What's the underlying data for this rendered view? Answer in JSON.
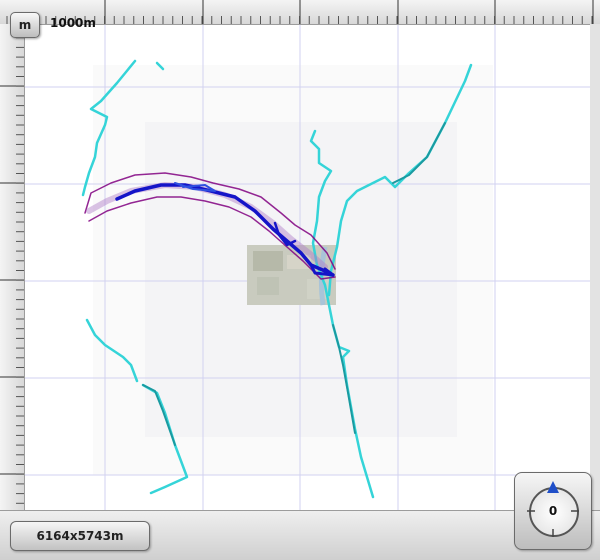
{
  "toolbar": {
    "unit_label": "m",
    "scale_label": "1000m"
  },
  "status": {
    "map_size": "6164x5743m"
  },
  "compass": {
    "heading": "0",
    "pointer_color": "#1f4fc8"
  },
  "map": {
    "track_colors": {
      "trail": "#35d4d8",
      "route": "#1414c8",
      "buffer": "#800080"
    },
    "has_photo_tile": true
  }
}
